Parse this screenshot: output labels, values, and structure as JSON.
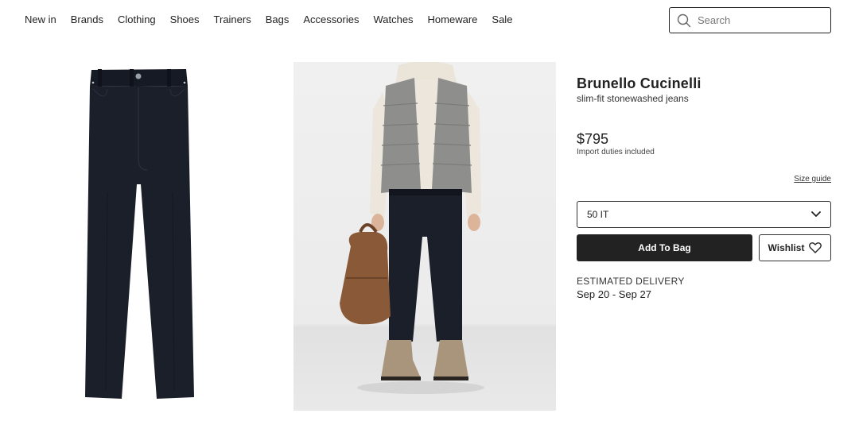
{
  "nav": {
    "links": [
      "New in",
      "Brands",
      "Clothing",
      "Shoes",
      "Trainers",
      "Bags",
      "Accessories",
      "Watches",
      "Homeware",
      "Sale"
    ],
    "search_placeholder": "Search",
    "search_icon": "search-icon"
  },
  "product": {
    "brand": "Brunello Cucinelli",
    "name": "slim-fit stonewashed jeans",
    "price": "$795",
    "duties_note": "Import duties included",
    "size_guide_label": "Size guide",
    "selected_size": "50 IT",
    "add_to_bag_label": "Add To Bag",
    "wishlist_label": "Wishlist",
    "delivery_title": "ESTIMATED DELIVERY",
    "delivery_dates": "Sep 20 - Sep 27",
    "colors": {
      "primary_button": "#222222",
      "jeans": "#1b1f2a"
    }
  }
}
